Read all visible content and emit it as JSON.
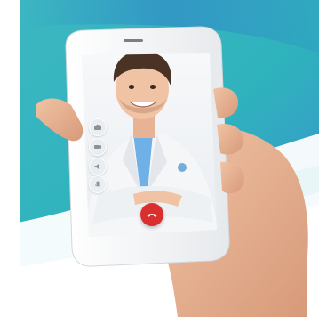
{
  "colors": {
    "background_teal": "#2fb3bd",
    "background_blue": "#2f7fc9",
    "accent_white": "#ffffff",
    "end_call_red": "#d92f2f",
    "coat_white": "#f4f6f8",
    "shirt_blue": "#6fb0e6"
  },
  "call_screen": {
    "controls": [
      {
        "name": "camera-switch",
        "icon": "camera-icon"
      },
      {
        "name": "video-toggle",
        "icon": "video-icon"
      },
      {
        "name": "speaker-toggle",
        "icon": "speaker-icon"
      },
      {
        "name": "mic-toggle",
        "icon": "microphone-icon"
      }
    ],
    "end_call_icon": "phone-hangup-icon"
  }
}
